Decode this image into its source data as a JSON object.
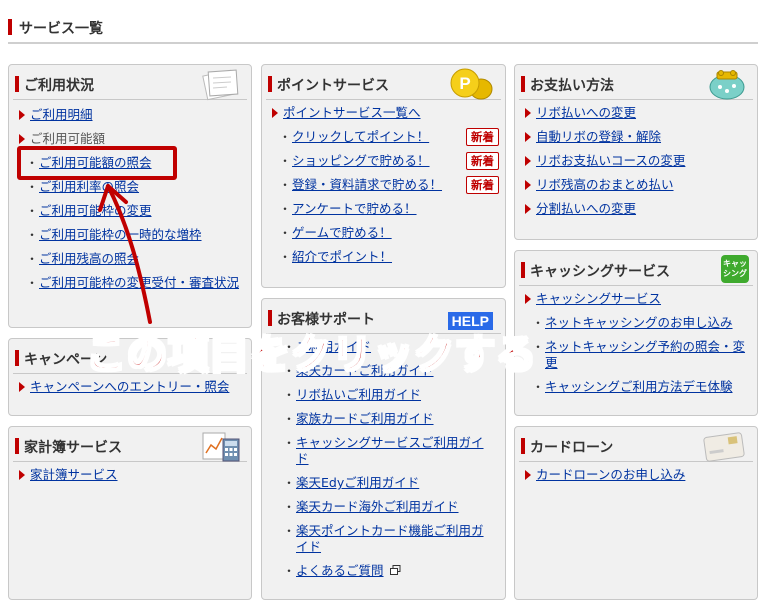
{
  "page_title": "サービス一覧",
  "panels": {
    "usage": {
      "title": "ご利用状況",
      "items": [
        {
          "label": "ご利用明細",
          "type": "main"
        },
        {
          "label": "ご利用可能額",
          "type": "main-plain"
        },
        {
          "label": "ご利用可能額の照会",
          "type": "sub"
        },
        {
          "label": "ご利用利率の照会",
          "type": "sub"
        },
        {
          "label": "ご利用可能枠の変更",
          "type": "sub"
        },
        {
          "label": "ご利用可能枠の一時的な増枠",
          "type": "sub"
        },
        {
          "label": "ご利用残高の照会",
          "type": "sub"
        },
        {
          "label": "ご利用可能枠の変更受付・審査状況",
          "type": "sub"
        }
      ]
    },
    "campaign": {
      "title": "キャンペーン",
      "items": [
        {
          "label": "キャンペーンへのエントリー・照会"
        }
      ]
    },
    "household": {
      "title": "家計簿サービス",
      "items": [
        {
          "label": "家計簿サービス"
        }
      ]
    },
    "points": {
      "title": "ポイントサービス",
      "items": [
        {
          "label": "ポイントサービス一覧へ",
          "badge": ""
        },
        {
          "label": "クリックしてポイント！",
          "badge": "新着"
        },
        {
          "label": "ショッピングで貯める！",
          "badge": "新着"
        },
        {
          "label": "登録・資料請求で貯める！",
          "badge": "新着"
        },
        {
          "label": "アンケートで貯める！",
          "badge": ""
        },
        {
          "label": "ゲームで貯める！",
          "badge": ""
        },
        {
          "label": "紹介でポイント！",
          "badge": ""
        }
      ]
    },
    "support": {
      "title": "お客様サポート",
      "help_label": "HELP",
      "items": [
        {
          "label": "ご利用ガイド"
        },
        {
          "label": "楽天カードご利用ガイド"
        },
        {
          "label": "リボ払いご利用ガイド"
        },
        {
          "label": "家族カードご利用ガイド"
        },
        {
          "label": "キャッシングサービスご利用ガイド"
        },
        {
          "label": "楽天Edyご利用ガイド"
        },
        {
          "label": "楽天カード海外ご利用ガイド"
        },
        {
          "label": "楽天ポイントカード機能ご利用ガイド"
        },
        {
          "label": "よくあるご質問"
        }
      ]
    },
    "payment": {
      "title": "お支払い方法",
      "items": [
        {
          "label": "リボ払いへの変更"
        },
        {
          "label": "自動リボの登録・解除"
        },
        {
          "label": "リボお支払いコースの変更"
        },
        {
          "label": "リボ残高のおまとめ払い"
        },
        {
          "label": "分割払いへの変更"
        }
      ]
    },
    "cashing": {
      "title": "キャッシングサービス",
      "icon_label": "キャッシング",
      "items": [
        {
          "label": "キャッシングサービス",
          "type": "main"
        },
        {
          "label": "ネットキャッシングのお申し込み",
          "type": "sub"
        },
        {
          "label": "ネットキャッシング予約の照会・変更",
          "type": "sub"
        },
        {
          "label": "キャッシングご利用方法デモ体験",
          "type": "sub"
        }
      ]
    },
    "loan": {
      "title": "カードローン",
      "items": [
        {
          "label": "カードローンのお申し込み"
        }
      ]
    }
  },
  "annotation": {
    "text": "この項目をクリックする"
  },
  "colors": {
    "accent_red": "#bf0000",
    "link_blue": "#0033a0",
    "annotation_red": "#c00000"
  }
}
